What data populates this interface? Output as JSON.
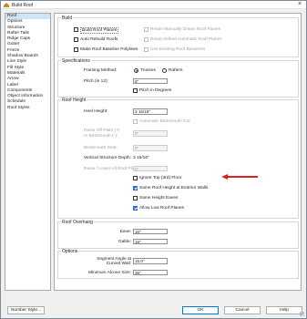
{
  "window": {
    "title": "Build Roof"
  },
  "sidebar": {
    "items": [
      {
        "label": "Roof",
        "selected": true
      },
      {
        "label": "Options"
      },
      {
        "label": "Structure"
      },
      {
        "label": "Rafter Tails"
      },
      {
        "label": "Ridge Caps"
      },
      {
        "label": "Gutter"
      },
      {
        "label": "Frieze"
      },
      {
        "label": "Shadow Boards"
      },
      {
        "label": "Line Style"
      },
      {
        "label": "Fill Style"
      },
      {
        "label": "Materials"
      },
      {
        "label": "Arrow"
      },
      {
        "label": "Label"
      },
      {
        "label": "Components"
      },
      {
        "label": "Object Information"
      },
      {
        "label": "Schedule"
      },
      {
        "label": "Roof Styles"
      }
    ]
  },
  "build": {
    "title": "Build",
    "build_roof_planes": "Build Roof Planes",
    "reset_manually": "Retain Manually Drawn Roof Planes",
    "auto_rebuild": "Auto Rebuild Roofs",
    "retain_edited": "Retain Edited Automatic Roof Planes",
    "make_baselines": "Make Roof Baseline Polylines",
    "use_existing": "Use Existing Roof Baselines"
  },
  "specifications": {
    "title": "Specifications",
    "framing_label": "Framing Method:",
    "trusses": "Trusses",
    "rafters": "Rafters",
    "pitch_label": "Pitch (in 12):",
    "pitch_value": "6\"",
    "pitch_degrees": "Pitch in Degrees"
  },
  "roof_height": {
    "title": "Roof Height",
    "heel_label": "Heel Height:",
    "heel_value": "3 15/16\"",
    "auto_birdsmouth": "Automatic Birdsmouth Cut",
    "raise_off_plate_1": "Raise Off Plate (+)",
    "raise_off_plate_2": "or Birdsmouth (-):",
    "raise_value": "0\"",
    "birdsmouth_seat_label": "Birdsmouth Seat:",
    "birdsmouth_seat_value": "0\"",
    "vertical_depth_label": "Vertical Structure Depth:",
    "vertical_depth_value": "3 15/16\"",
    "raise_lower_label": "Raise / Lower All Roof Planes:",
    "raise_lower_value": "0\"",
    "ignore_top": "Ignore Top (3rd) Floor",
    "same_height_walls": "Same Roof Height at Exterior Walls",
    "same_eaves": "Same Height Eaves",
    "allow_low": "Allow Low Roof Planes"
  },
  "overhang": {
    "title": "Roof Overhang",
    "eave_label": "Eave:",
    "eave_value": "16\"",
    "gable_label": "Gable:",
    "gable_value": "16\""
  },
  "options": {
    "title": "Options",
    "segment_label_1": "Segment Angle at",
    "segment_label_2": "Curved Wall:",
    "segment_value": "15.0°",
    "alcove_label": "Minimum Alcove Size:",
    "alcove_value": "36\""
  },
  "footer": {
    "number_style": "Number Style...",
    "ok": "OK",
    "cancel": "Cancel",
    "help": "Help"
  },
  "colors": {
    "accent": "#1e6fd9",
    "arrow": "#e02020"
  }
}
